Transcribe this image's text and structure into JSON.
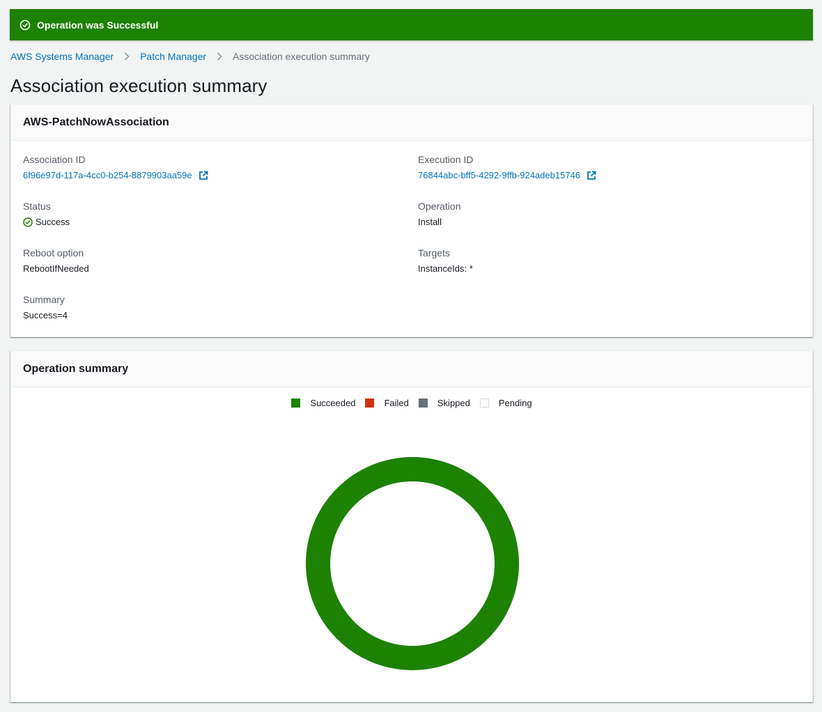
{
  "flash": {
    "message": "Operation was Successful"
  },
  "breadcrumb": {
    "items": [
      "AWS Systems Manager",
      "Patch Manager"
    ],
    "current": "Association execution summary"
  },
  "page": {
    "title": "Association execution summary"
  },
  "details": {
    "title": "AWS-PatchNowAssociation",
    "association_id": {
      "label": "Association ID",
      "value": "6f96e97d-117a-4cc0-b254-8879903aa59e"
    },
    "execution_id": {
      "label": "Execution ID",
      "value": "76844abc-bff5-4292-9ffb-924adeb15746"
    },
    "status": {
      "label": "Status",
      "value": "Success"
    },
    "operation": {
      "label": "Operation",
      "value": "Install"
    },
    "reboot_option": {
      "label": "Reboot option",
      "value": "RebootIfNeeded"
    },
    "targets": {
      "label": "Targets",
      "value": "InstanceIds: *"
    },
    "summary": {
      "label": "Summary",
      "value": "Success=4"
    }
  },
  "operation_summary": {
    "title": "Operation summary",
    "legend": [
      {
        "label": "Succeeded",
        "color": "#1d8102"
      },
      {
        "label": "Failed",
        "color": "#d13212"
      },
      {
        "label": "Skipped",
        "color": "#687078"
      },
      {
        "label": "Pending",
        "color": "#ffffff"
      }
    ]
  },
  "chart_data": {
    "type": "pie",
    "categories": [
      "Succeeded",
      "Failed",
      "Skipped",
      "Pending"
    ],
    "values": [
      4,
      0,
      0,
      0
    ],
    "colors": [
      "#1d8102",
      "#d13212",
      "#687078",
      "#ffffff"
    ],
    "legend_position": "top-center"
  },
  "colors": {
    "success": "#1d8102",
    "link": "#0073bb",
    "background": "#f2f3f3"
  }
}
